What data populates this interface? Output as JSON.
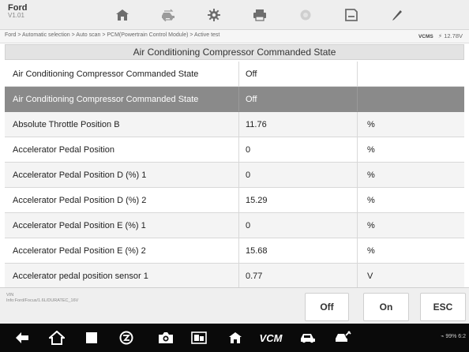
{
  "app": {
    "name": "Ford",
    "version": "V1.01"
  },
  "toolbar": {
    "items": [
      {
        "icon": "home-icon"
      },
      {
        "icon": "vehicle-swap-icon"
      },
      {
        "icon": "gear-icon"
      },
      {
        "icon": "printer-icon"
      },
      {
        "icon": "record-icon"
      },
      {
        "icon": "save-icon"
      },
      {
        "icon": "pen-icon"
      }
    ]
  },
  "breadcrumb": "Ford > Automatic selection > Auto scan > PCM(Powertrain Control Module) > Active test",
  "status": {
    "vcm_label": "VCMS",
    "voltage": "12.78V"
  },
  "title": "Air Conditioning Compressor Commanded State",
  "rows": [
    {
      "name": "Air Conditioning Compressor Commanded State",
      "value": "Off",
      "unit": ""
    },
    {
      "name": "Air Conditioning Compressor Commanded State",
      "value": "Off",
      "unit": ""
    },
    {
      "name": "Absolute Throttle Position B",
      "value": "11.76",
      "unit": "%"
    },
    {
      "name": "Accelerator Pedal Position",
      "value": "0",
      "unit": "%"
    },
    {
      "name": "Accelerator Pedal Position D (%) 1",
      "value": "0",
      "unit": "%"
    },
    {
      "name": "Accelerator Pedal Position D (%) 2",
      "value": "15.29",
      "unit": "%"
    },
    {
      "name": "Accelerator Pedal Position E (%) 1",
      "value": "0",
      "unit": "%"
    },
    {
      "name": "Accelerator Pedal Position E (%) 2",
      "value": "15.68",
      "unit": "%"
    },
    {
      "name": "Accelerator pedal position sensor 1",
      "value": "0.77",
      "unit": "V"
    }
  ],
  "selected_row": 1,
  "footer": {
    "vin_label": "VIN",
    "vin_info": "Info:Ford/Focus/1.6L/DURATEC_16V",
    "buttons": {
      "off": "Off",
      "on": "On",
      "esc": "ESC"
    }
  },
  "navbar": {
    "vcm_label": "VCM",
    "status_text": "99% 6:2"
  },
  "colors": {
    "toolbar_bg": "#eeeeee",
    "selected_row_bg": "#8a8a8a",
    "navbar_bg": "#0a0a0a"
  }
}
